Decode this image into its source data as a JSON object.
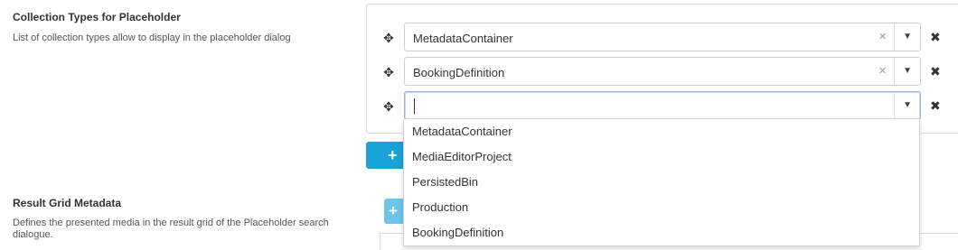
{
  "collection_types": {
    "title": "Collection Types for Placeholder",
    "description": "List of collection types allow to display in the placeholder dialog",
    "items": [
      {
        "value": "MetadataContainer"
      },
      {
        "value": "BookingDefinition"
      },
      {
        "value": ""
      }
    ],
    "dropdown_options": [
      "MetadataContainer",
      "MediaEditorProject",
      "PersistedBin",
      "Production",
      "BookingDefinition"
    ],
    "add_label": "+"
  },
  "result_grid": {
    "title": "Result Grid Metadata",
    "description": "Defines the presented media in the result grid of the Placeholder search dialogue.",
    "add_label": "+"
  },
  "icons": {
    "drag": "move-icon",
    "clear": "clear-icon",
    "arrow": "chevron-down-icon",
    "remove": "remove-icon"
  },
  "colors": {
    "add_button": "#1aa3d8",
    "add_button_disabled": "#6cc6ea"
  }
}
